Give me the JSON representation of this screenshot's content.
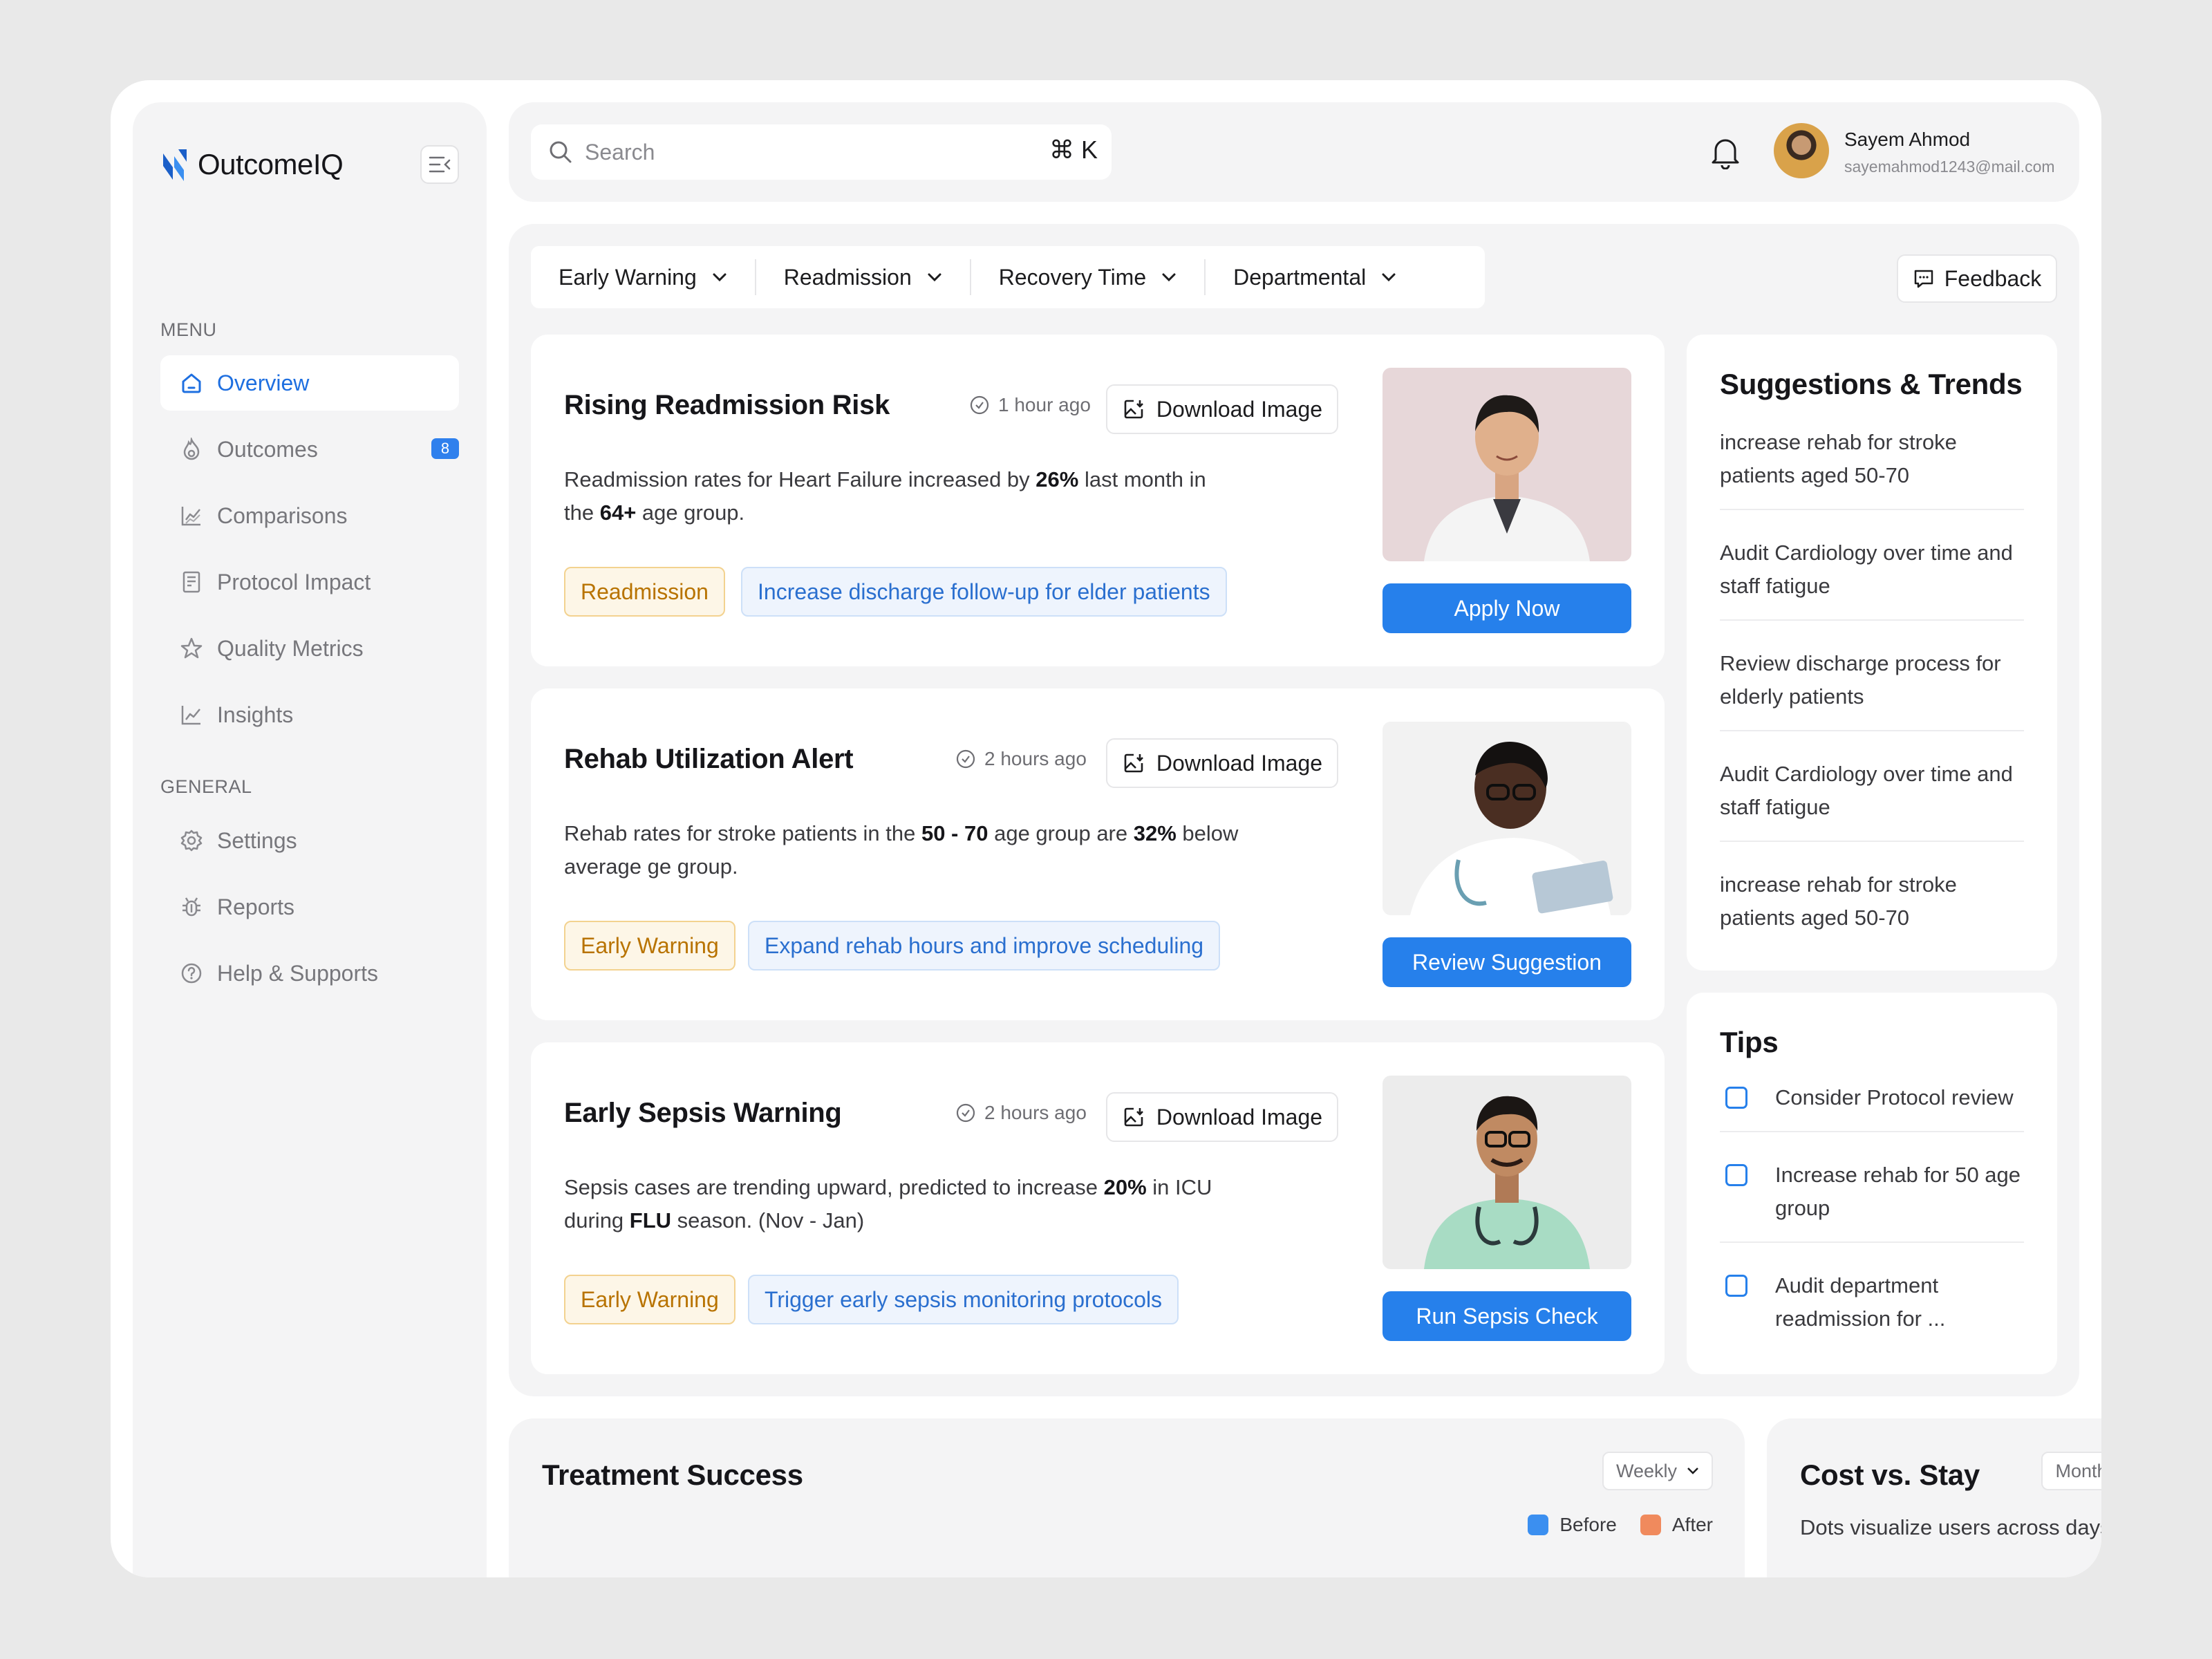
{
  "app": {
    "name": "OutcomeIQ",
    "accent": "#2680eb",
    "warn": "#b87300"
  },
  "search": {
    "placeholder": "Search",
    "shortcut": "⌘ K"
  },
  "user": {
    "name": "Sayem Ahmod",
    "email": "sayemahmod1243@mail.com"
  },
  "sidebar": {
    "menu_heading": "MENU",
    "general_heading": "GENERAL",
    "menu": [
      {
        "label": "Overview",
        "icon": "home-icon",
        "active": true
      },
      {
        "label": "Outcomes",
        "icon": "flame-icon",
        "badge": "8"
      },
      {
        "label": "Comparisons",
        "icon": "chart-icon"
      },
      {
        "label": "Protocol Impact",
        "icon": "clipboard-icon"
      },
      {
        "label": "Quality Metrics",
        "icon": "star-icon"
      },
      {
        "label": "Insights",
        "icon": "trend-icon"
      }
    ],
    "general": [
      {
        "label": "Settings",
        "icon": "gear-icon"
      },
      {
        "label": "Reports",
        "icon": "bug-icon"
      },
      {
        "label": "Help & Supports",
        "icon": "help-icon"
      }
    ]
  },
  "filters": {
    "tabs": [
      "Early Warning",
      "Readmission",
      "Recovery Time",
      "Departmental"
    ],
    "feedback": "Feedback"
  },
  "cards": [
    {
      "title": "Rising Readmission Risk",
      "time": "1 hour ago",
      "download": "Download Image",
      "body": [
        "Readmission rates for Heart Failure increased by ",
        "26%",
        " last month in the ",
        "64+",
        " age group."
      ],
      "tag": "Readmission",
      "suggestion": "Increase discharge follow-up for elder patients",
      "cta": "Apply Now"
    },
    {
      "title": "Rehab Utilization Alert",
      "time": "2 hours ago",
      "download": "Download Image",
      "body": [
        "Rehab rates for stroke patients in the  ",
        "50 - 70",
        " age group are  ",
        "32%",
        " below average ge group."
      ],
      "tag": "Early Warning",
      "suggestion": "Expand rehab hours and improve scheduling",
      "cta": "Review Suggestion"
    },
    {
      "title": "Early Sepsis Warning",
      "time": "2 hours ago",
      "download": "Download Image",
      "body": [
        "Sepsis cases are trending upward, predicted to increase  ",
        "20%",
        " in ICU during ",
        "FLU",
        " season. (Nov - Jan)"
      ],
      "tag": "Early Warning",
      "suggestion": "Trigger early sepsis monitoring protocols",
      "cta": "Run Sepsis Check"
    }
  ],
  "suggestions": {
    "title": "Suggestions & Trends",
    "items": [
      "increase rehab for stroke patients aged 50-70",
      "Audit Cardiology over time and staff fatigue",
      "Review discharge process for elderly patients",
      "Audit Cardiology over time and staff fatigue",
      "increase rehab for stroke patients aged 50-70"
    ]
  },
  "tips": {
    "title": "Tips",
    "items": [
      "Consider Protocol review",
      "Increase rehab for 50 age group",
      "Audit department readmission for ..."
    ]
  },
  "treatment": {
    "title": "Treatment Success",
    "range": "Weekly",
    "legend": [
      {
        "label": "Before",
        "color": "#3b8ff0"
      },
      {
        "label": "After",
        "color": "#f08a5d"
      }
    ]
  },
  "cost": {
    "title": "Cost vs. Stay",
    "range": "Monthly",
    "subtitle": "Dots visualize users across days."
  }
}
